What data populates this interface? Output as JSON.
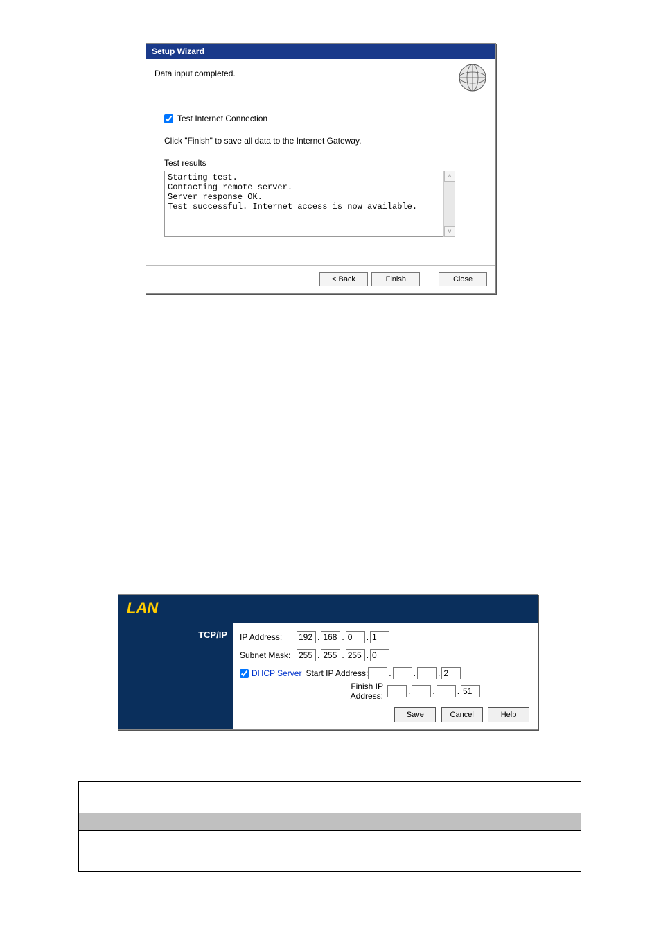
{
  "wizard": {
    "title": "Setup Wizard",
    "header_text": "Data input completed.",
    "test_checkbox_checked": true,
    "test_checkbox_label": "Test Internet Connection",
    "instruction": "Click \"Finish\" to save all data to the Internet Gateway.",
    "results_label": "Test results",
    "results_text": "Starting test.\nContacting remote server.\nServer response OK.\nTest successful. Internet access is now available.",
    "buttons": {
      "back": "< Back",
      "finish": "Finish",
      "close": "Close"
    },
    "scroll_up_glyph": "˄",
    "scroll_down_glyph": "˅"
  },
  "lan": {
    "title": "LAN",
    "section": "TCP/IP",
    "labels": {
      "ip_address": "IP Address:",
      "subnet_mask": "Subnet Mask:",
      "dhcp_server": "DHCP Server",
      "start_ip": "Start IP Address:",
      "finish_ip": "Finish IP Address:"
    },
    "dhcp_checked": true,
    "ip_address": [
      "192",
      "168",
      "0",
      "1"
    ],
    "subnet_mask": [
      "255",
      "255",
      "255",
      "0"
    ],
    "start_ip": [
      "",
      "",
      "",
      "2"
    ],
    "finish_ip": [
      "",
      "",
      "",
      "51"
    ],
    "buttons": {
      "save": "Save",
      "cancel": "Cancel",
      "help": "Help"
    },
    "dot": "."
  }
}
